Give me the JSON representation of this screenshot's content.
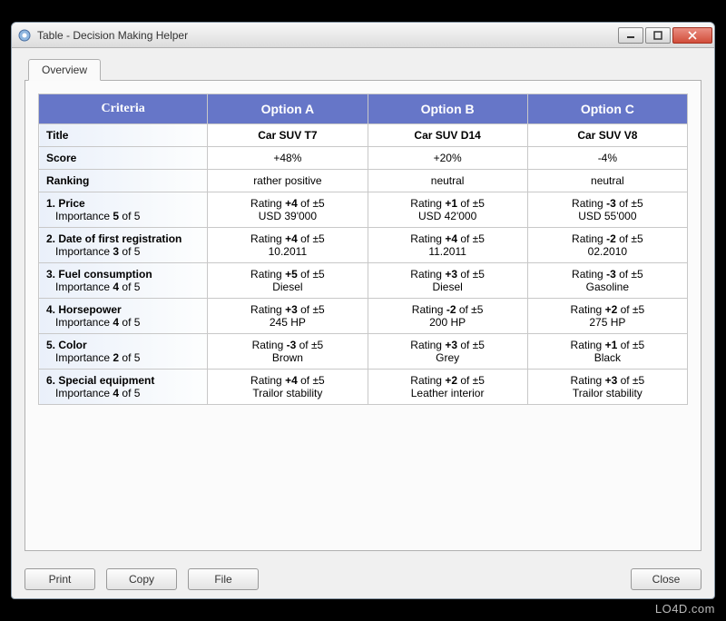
{
  "window": {
    "title": "Table - Decision Making Helper"
  },
  "tab": {
    "overview": "Overview"
  },
  "headers": {
    "criteria": "Criteria",
    "optA": "Option A",
    "optB": "Option B",
    "optC": "Option C"
  },
  "labels": {
    "title": "Title",
    "score": "Score",
    "ranking": "Ranking",
    "importance_prefix": "Importance ",
    "importance_suffix": " of 5",
    "rating_prefix": "Rating ",
    "rating_suffix": " of ±5"
  },
  "options": {
    "A": {
      "title": "Car SUV T7",
      "score": "+48%",
      "ranking": "rather positive"
    },
    "B": {
      "title": "Car SUV D14",
      "score": "+20%",
      "ranking": "neutral"
    },
    "C": {
      "title": "Car SUV V8",
      "score": "-4%",
      "ranking": "neutral"
    }
  },
  "criteria": [
    {
      "name": "1. Price",
      "importance": "5",
      "A": {
        "rating": "+4",
        "value": "USD 39'000"
      },
      "B": {
        "rating": "+1",
        "value": "USD 42'000"
      },
      "C": {
        "rating": "-3",
        "value": "USD 55'000"
      }
    },
    {
      "name": "2. Date of first registration",
      "importance": "3",
      "A": {
        "rating": "+4",
        "value": "10.2011"
      },
      "B": {
        "rating": "+4",
        "value": "11.2011"
      },
      "C": {
        "rating": "-2",
        "value": "02.2010"
      }
    },
    {
      "name": "3. Fuel consumption",
      "importance": "4",
      "A": {
        "rating": "+5",
        "value": "Diesel"
      },
      "B": {
        "rating": "+3",
        "value": "Diesel"
      },
      "C": {
        "rating": "-3",
        "value": "Gasoline"
      }
    },
    {
      "name": "4. Horsepower",
      "importance": "4",
      "A": {
        "rating": "+3",
        "value": "245 HP"
      },
      "B": {
        "rating": "-2",
        "value": "200 HP"
      },
      "C": {
        "rating": "+2",
        "value": "275 HP"
      }
    },
    {
      "name": "5. Color",
      "importance": "2",
      "A": {
        "rating": "-3",
        "value": "Brown"
      },
      "B": {
        "rating": "+3",
        "value": "Grey"
      },
      "C": {
        "rating": "+1",
        "value": "Black"
      }
    },
    {
      "name": "6. Special equipment",
      "importance": "4",
      "A": {
        "rating": "+4",
        "value": "Trailor stability"
      },
      "B": {
        "rating": "+2",
        "value": "Leather interior"
      },
      "C": {
        "rating": "+3",
        "value": "Trailor stability"
      }
    }
  ],
  "buttons": {
    "print": "Print",
    "copy": "Copy",
    "file": "File",
    "close": "Close"
  },
  "watermark": "LO4D.com"
}
